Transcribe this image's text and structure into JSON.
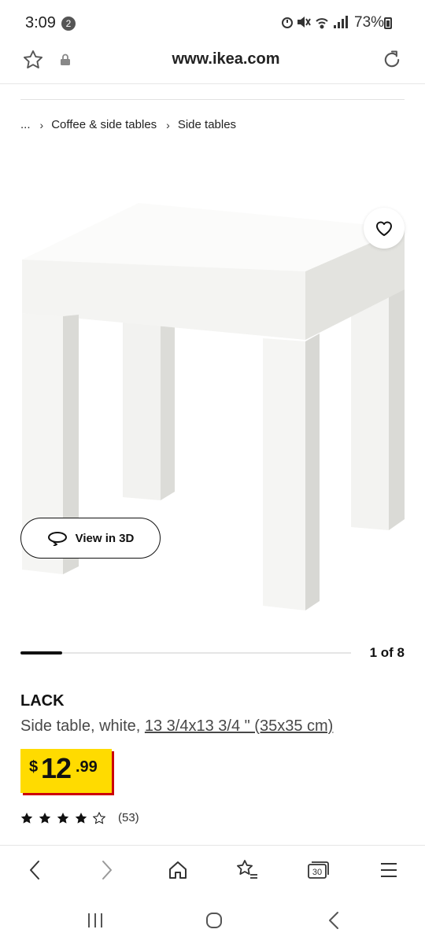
{
  "status_bar": {
    "time": "3:09",
    "notification_count": "2",
    "battery": "73%"
  },
  "browser": {
    "url": "www.ikea.com",
    "tab_count": "30"
  },
  "breadcrumb": {
    "ellipsis": "...",
    "items": [
      "Coffee & side tables",
      "Side tables"
    ]
  },
  "product": {
    "view_3d_label": "View in 3D",
    "carousel_position": "1 of 8",
    "carousel_progress": 0.125,
    "name": "LACK",
    "description_prefix": "Side table, white, ",
    "description_dimensions": "13 3/4x13 3/4 \" (35x35 cm)",
    "price": {
      "currency": "$",
      "whole": "12",
      "cents": ".99"
    },
    "rating": {
      "stars": 4.5,
      "count": "(53)"
    }
  },
  "colors": {
    "price_yellow": "#ffdb00",
    "price_red": "#cc0008"
  }
}
